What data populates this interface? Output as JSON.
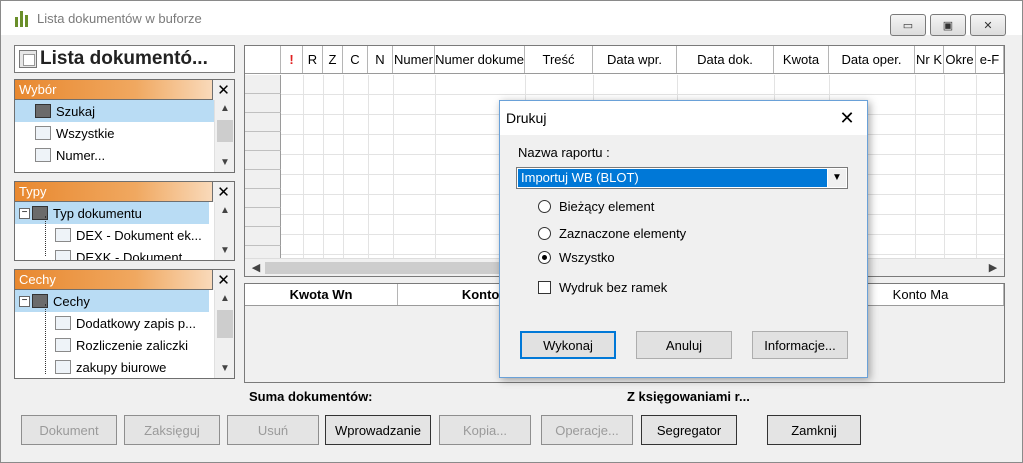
{
  "window": {
    "title": "Lista dokumentów w buforze"
  },
  "panel": {
    "title": "Lista dokumentó..."
  },
  "wybor": {
    "header": "Wybór",
    "items": [
      "Szukaj",
      "Wszystkie",
      "Numer..."
    ]
  },
  "typy": {
    "header": "Typy",
    "root": "Typ dokumentu",
    "children": [
      "DEX - Dokument ek...",
      "DEXK - Dokument"
    ]
  },
  "cechy": {
    "header": "Cechy",
    "root": "Cechy",
    "children": [
      "Dodatkowy zapis p...",
      "Rozliczenie zaliczki",
      "zakupy biurowe"
    ]
  },
  "grid": {
    "columns": [
      "!",
      "R",
      "Z",
      "C",
      "N",
      "Numer",
      "Numer dokume",
      "Treść",
      "Data wpr.",
      "Data dok.",
      "Kwota",
      "Data oper.",
      "Nr K",
      "Okre",
      "e-F"
    ]
  },
  "summary": {
    "columns": [
      "Kwota Wn",
      "Konto Wn",
      "",
      "Konto Ma"
    ],
    "suma_label": "Suma dokumentów:",
    "ksieg_label": "Z księgowaniami r..."
  },
  "buttons": {
    "dokument": "Dokument",
    "zaksieguj": "Zaksięguj",
    "usun": "Usuń",
    "wprowadzanie": "Wprowadzanie",
    "kopia": "Kopia...",
    "operacje": "Operacje...",
    "segregator": "Segregator",
    "zamknij": "Zamknij"
  },
  "dialog": {
    "title": "Drukuj",
    "report_label": "Nazwa raportu :",
    "report_value": "Importuj WB (BLOT)",
    "radio_current": "Bieżący element",
    "radio_selected": "Zaznaczone elementy",
    "radio_all": "Wszystko",
    "checkbox_noborders": "Wydruk bez ramek",
    "btn_execute": "Wykonaj",
    "btn_cancel": "Anuluj",
    "btn_info": "Informacje..."
  },
  "colors": {
    "section_header": "#e8882f",
    "selection": "#b9dcf4",
    "combo_highlight": "#0078d7"
  }
}
